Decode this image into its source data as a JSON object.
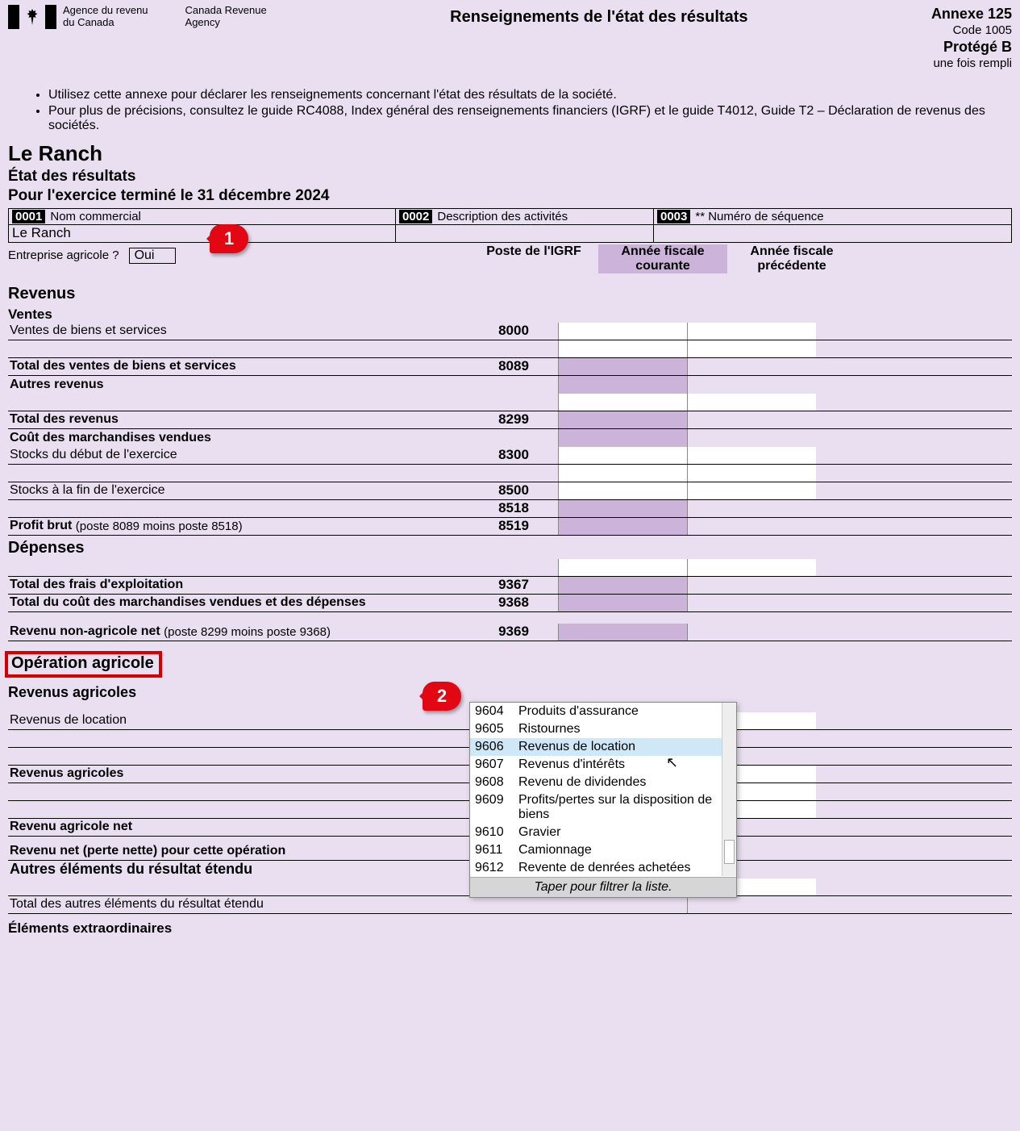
{
  "header": {
    "agency_fr_1": "Agence du revenu",
    "agency_fr_2": "du Canada",
    "agency_en_1": "Canada Revenue",
    "agency_en_2": "Agency",
    "title": "Renseignements de l'état des résultats",
    "annex": "Annexe 125",
    "code": "Code 1005",
    "protected": "Protégé B",
    "once": "une fois rempli"
  },
  "instructions": [
    "Utilisez cette annexe pour déclarer les renseignements concernant l'état des résultats de la société.",
    "Pour plus de précisions, consultez le guide RC4088, Index général des renseignements financiers (IGRF) et le guide T4012, Guide T2 – Déclaration de revenus des sociétés."
  ],
  "company": "Le Ranch",
  "subtitle": "État des résultats",
  "period": "Pour l'exercice terminé le 31 décembre 2024",
  "fields": {
    "f1_code": "0001",
    "f1_label": "Nom commercial",
    "f1_value": "Le Ranch",
    "f2_code": "0002",
    "f2_label": "Description des activités",
    "f3_code": "0003",
    "f3_label": "** Numéro de séquence"
  },
  "ag_question": "Entreprise agricole ?",
  "ag_answer": "Oui",
  "col_headers": {
    "gcode": "Poste de l'IGRF",
    "cur": "Année fiscale courante",
    "prev": "Année fiscale précédente"
  },
  "sections": {
    "revenus": "Revenus",
    "ventes": "Ventes",
    "depenses": "Dépenses",
    "op_agricole": "Opération agricole",
    "rev_agricoles": "Revenus agricoles"
  },
  "lines": {
    "ventes_biens": {
      "label": "Ventes de biens et services",
      "code": "8000"
    },
    "total_ventes": {
      "label": "Total des ventes de biens et services",
      "code": "8089"
    },
    "autres_rev": {
      "label": "Autres revenus",
      "code": ""
    },
    "total_rev": {
      "label": "Total des revenus",
      "code": "8299"
    },
    "cout_marchv": {
      "label": "Coût des marchandises vendues",
      "code": ""
    },
    "stocks_debut": {
      "label": "Stocks du début de l'exercice",
      "code": "8300"
    },
    "stocks_fin": {
      "label": "Stocks à la fin de l'exercice",
      "code": "8500"
    },
    "l8518": {
      "label": "",
      "code": "8518"
    },
    "profit_brut": {
      "label": "Profit brut",
      "note": "(poste 8089 moins poste 8518)",
      "code": "8519"
    },
    "total_frais": {
      "label": "Total des frais d'exploitation",
      "code": "9367"
    },
    "total_cout": {
      "label": "Total du coût des marchandises vendues et des dépenses",
      "code": "9368"
    },
    "rev_non_ag": {
      "label": "Revenu non-agricole net",
      "note": "(poste 8299 moins poste 9368)",
      "code": "9369"
    },
    "rev_location": {
      "label": "Revenus de location",
      "code": "9606"
    },
    "rev_ag_total": {
      "label": "Revenus agricoles",
      "code": ""
    },
    "rev_ag_net": {
      "label": "Revenu agricole net",
      "code": ""
    },
    "rev_net": {
      "label": "Revenu net (perte nette) pour cette opération",
      "code": ""
    },
    "autres_el": {
      "label": "Autres éléments du résultat étendu",
      "code": ""
    },
    "total_autres_el": {
      "label": "Total des autres éléments du résultat étendu",
      "code": ""
    },
    "el_extra": {
      "label": "Éléments extraordinaires",
      "code": ""
    }
  },
  "callouts": {
    "c1": "1",
    "c2": "2"
  },
  "dropdown": {
    "options": [
      {
        "code": "9604",
        "label": "Produits d'assurance"
      },
      {
        "code": "9605",
        "label": "Ristournes"
      },
      {
        "code": "9606",
        "label": "Revenus de location",
        "selected": true
      },
      {
        "code": "9607",
        "label": "Revenus d'intérêts"
      },
      {
        "code": "9608",
        "label": "Revenu de dividendes"
      },
      {
        "code": "9609",
        "label": "Profits/pertes sur la disposition de biens"
      },
      {
        "code": "9610",
        "label": "Gravier"
      },
      {
        "code": "9611",
        "label": "Camionnage"
      },
      {
        "code": "9612",
        "label": "Revente de denrées achetées"
      }
    ],
    "footer": "Taper pour filtrer la liste."
  }
}
